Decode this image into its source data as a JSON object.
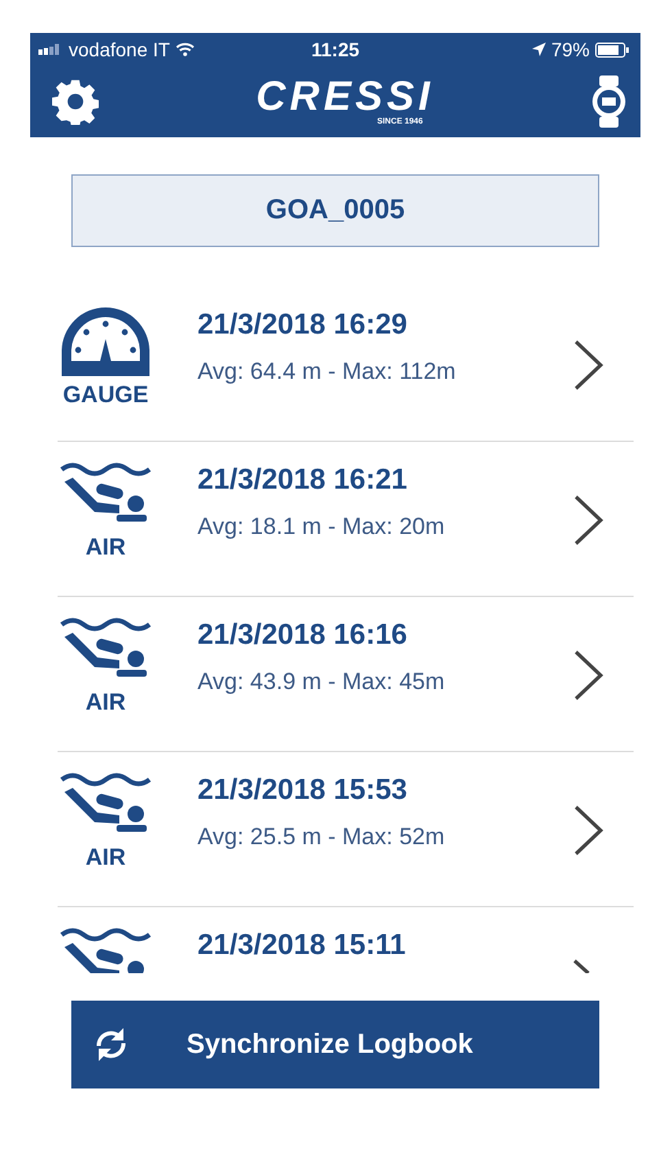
{
  "status_bar": {
    "carrier": "vodafone IT",
    "time": "11:25",
    "battery": "79%"
  },
  "header": {
    "logo": "CRESSI",
    "logo_tagline": "SINCE 1946"
  },
  "device": {
    "name": "GOA_0005"
  },
  "dives": [
    {
      "kind": "gauge",
      "mode": "GAUGE",
      "datetime": "21/3/2018 16:29",
      "depths": "Avg: 64.4 m - Max: 112m"
    },
    {
      "kind": "air",
      "mode": "AIR",
      "datetime": "21/3/2018 16:21",
      "depths": "Avg: 18.1 m - Max: 20m"
    },
    {
      "kind": "air",
      "mode": "AIR",
      "datetime": "21/3/2018 16:16",
      "depths": "Avg: 43.9 m - Max: 45m"
    },
    {
      "kind": "air",
      "mode": "AIR",
      "datetime": "21/3/2018 15:53",
      "depths": "Avg: 25.5 m - Max: 52m"
    },
    {
      "kind": "air",
      "datetime": "21/3/2018 15:11"
    }
  ],
  "sync_button": {
    "label": "Synchronize Logbook"
  }
}
